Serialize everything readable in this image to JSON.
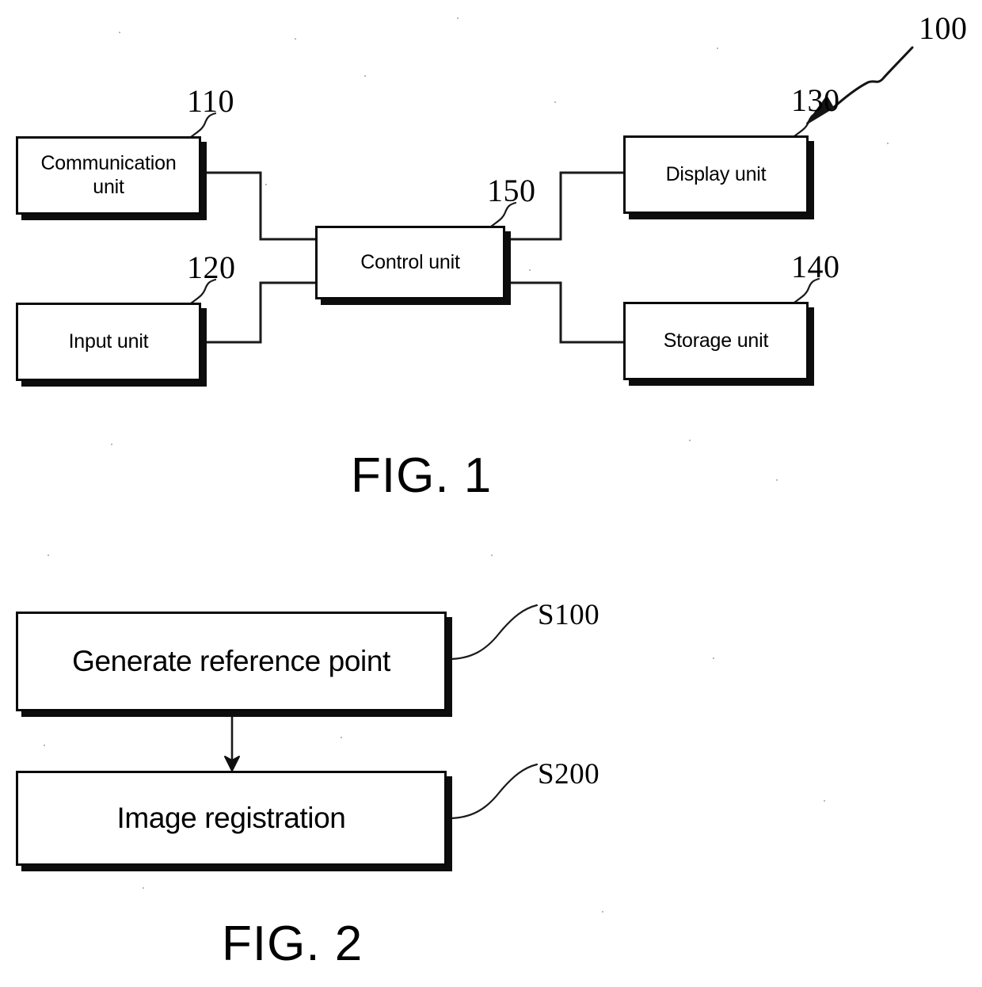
{
  "document": {
    "kind": "patent-figure-sheet",
    "figures": [
      "FIG. 1",
      "FIG. 2"
    ]
  },
  "fig1": {
    "caption": "FIG. 1",
    "system_ref": "100",
    "boxes": [
      {
        "id": "communication-unit",
        "label_line1": "Communication",
        "label_line2": "unit",
        "ref": "110"
      },
      {
        "id": "input-unit",
        "label_line1": "Input unit",
        "label_line2": "",
        "ref": "120"
      },
      {
        "id": "control-unit",
        "label_line1": "Control unit",
        "label_line2": "",
        "ref": "150"
      },
      {
        "id": "display-unit",
        "label_line1": "Display unit",
        "label_line2": "",
        "ref": "130"
      },
      {
        "id": "storage-unit",
        "label_line1": "Storage unit",
        "label_line2": "",
        "ref": "140"
      }
    ]
  },
  "fig2": {
    "caption": "FIG. 2",
    "steps": [
      {
        "id": "generate-reference-point",
        "label": "Generate reference point",
        "ref": "S100"
      },
      {
        "id": "image-registration",
        "label": "Image registration",
        "ref": "S200"
      }
    ]
  },
  "colors": {
    "ink": "#000000",
    "paper": "#ffffff",
    "shadow": "#0d0d0d"
  }
}
